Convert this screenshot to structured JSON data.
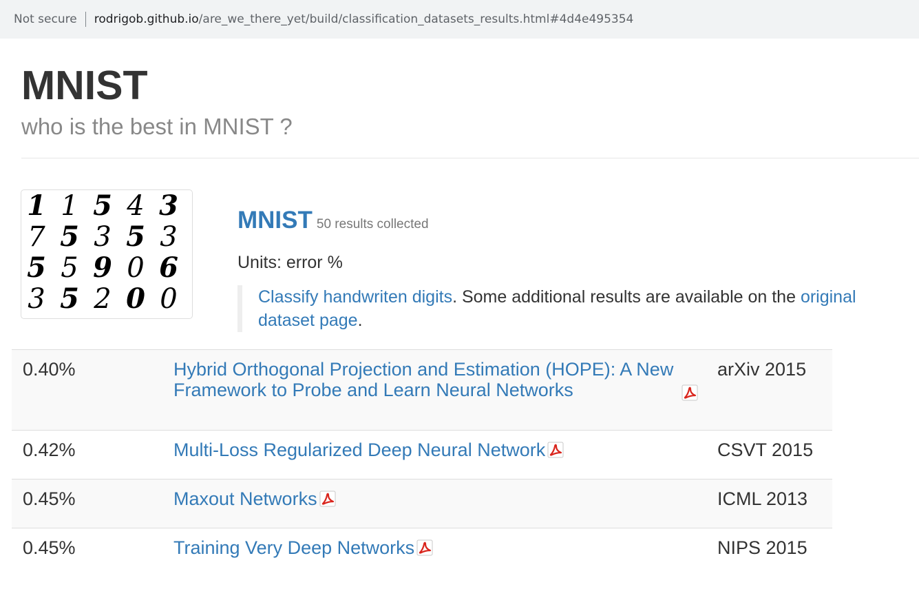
{
  "browser": {
    "security_label": "Not secure",
    "url_host": "rodrigob.github.io",
    "url_path": "/are_we_there_yet/build/classification_datasets_results.html#4d4e495354"
  },
  "header": {
    "title": "MNIST",
    "subtitle": "who is the best in MNIST ?"
  },
  "thumbnail_digits": [
    [
      "1",
      "1",
      "5",
      "4",
      "3"
    ],
    [
      "7",
      "5",
      "3",
      "5",
      "3"
    ],
    [
      "5",
      "5",
      "9",
      "0",
      "6"
    ],
    [
      "3",
      "5",
      "2",
      "0",
      "0"
    ]
  ],
  "dataset": {
    "name": "MNIST",
    "results_count": "50 results collected",
    "units": "Units: error %",
    "description_link": "Classify handwriten digits",
    "description_text": ". Some additional results are available on the ",
    "original_link": "original dataset page",
    "description_end": "."
  },
  "results": [
    {
      "result": "0.40%",
      "paper": "Hybrid Orthogonal Projection and Estimation (HOPE): A New Framework to Probe and Learn Neural Networks",
      "venue": "arXiv 2015"
    },
    {
      "result": "0.42%",
      "paper": "Multi-Loss Regularized Deep Neural Network",
      "venue": "CSVT 2015"
    },
    {
      "result": "0.45%",
      "paper": "Maxout Networks",
      "venue": "ICML 2013"
    },
    {
      "result": "0.45%",
      "paper": "Training Very Deep Networks",
      "venue": "NIPS 2015"
    }
  ],
  "colors": {
    "link": "#337ab7",
    "pdf_icon": "#d9251d"
  },
  "icons": {
    "pdf": "pdf-icon"
  }
}
